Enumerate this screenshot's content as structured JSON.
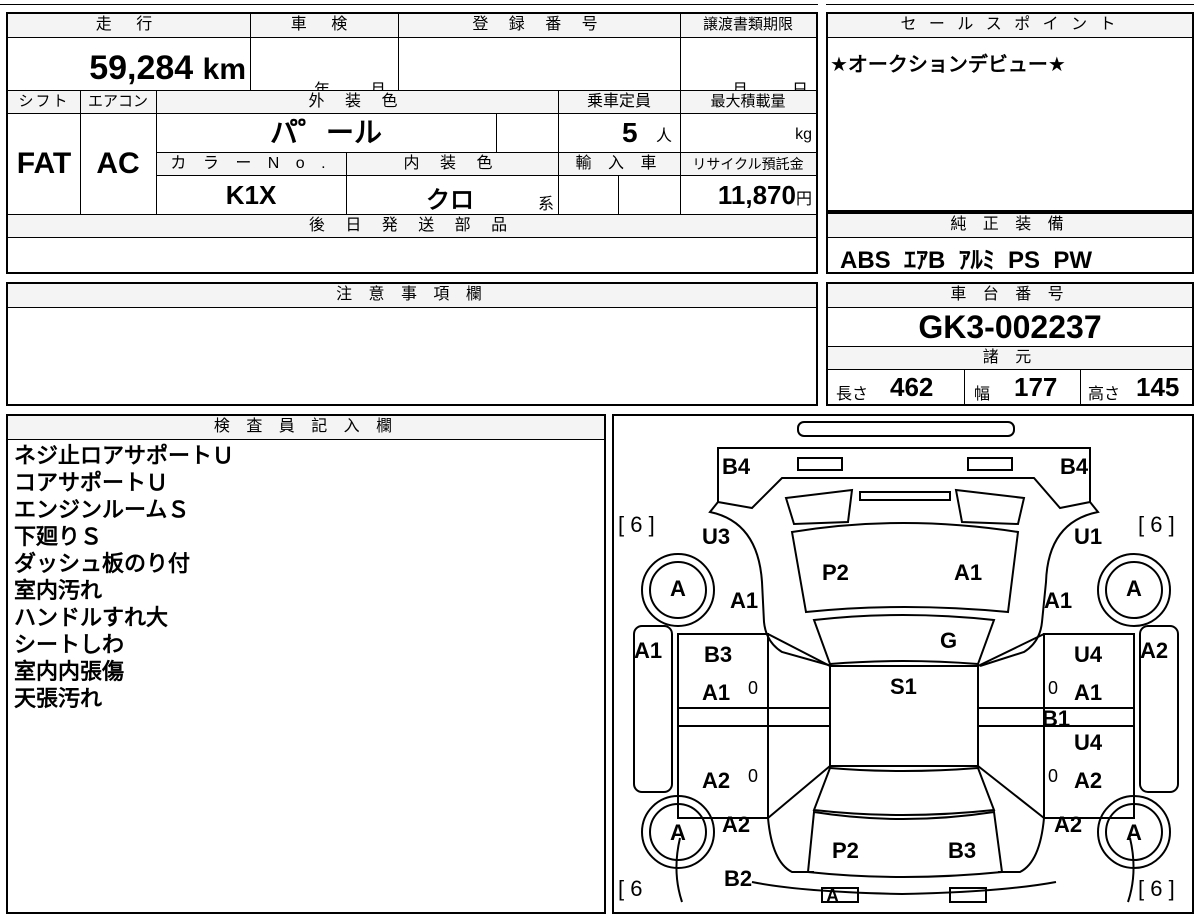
{
  "labels": {
    "mileage": "走 行",
    "inspection": "車 検",
    "registration_no": "登 録 番 号",
    "transfer_deadline": "譲渡書類期限",
    "sales_point": "セ ー ル ス ポ イ ン ト",
    "shift": "シフト",
    "aircon": "エアコン",
    "exterior_color": "外 装 色",
    "capacity": "乗車定員",
    "max_load": "最大積載量",
    "color_no": "カ ラ ー N o .",
    "interior_color": "内 装 色",
    "import": "輸 入 車",
    "recycle_fee": "リサイクル預託金",
    "later_parts": "後 日 発 送 部 品",
    "genuine_equipment": "純 正 装 備",
    "notes": "注 意 事 項 欄",
    "chassis_no": "車 台 番 号",
    "specs": "諸 元",
    "inspector": "検 査 員 記 入 欄"
  },
  "values": {
    "mileage": "59,284",
    "mileage_unit": "km",
    "insp_year": "年",
    "insp_month": "月",
    "deadline_month": "月",
    "deadline_day": "日",
    "sales_point": "★オークションデビュー★",
    "shift": "FAT",
    "aircon": "AC",
    "exterior_color": "パ゜ール",
    "capacity": "5",
    "capacity_unit": "人",
    "load_unit": "kg",
    "color_no": "K1X",
    "interior_color": "クロ",
    "interior_suffix": "系",
    "recycle_fee": "11,870",
    "recycle_unit": "円",
    "genuine_equipment": "ABS  ｴｱB  ｱﾙﾐ  PS  PW",
    "chassis_no": "GK3-002237",
    "length_label": "長さ",
    "length": "462",
    "width_label": "幅",
    "width": "177",
    "height_label": "高さ",
    "height": "145"
  },
  "inspector_notes": [
    "ネジ止ロアサポートＵ",
    "コアサポートＵ",
    "エンジンルームＳ",
    "下廻りＳ",
    "ダッシュ板のり付",
    "室内汚れ",
    "ハンドルすれ大",
    "シートしわ",
    "室内内張傷",
    "天張汚れ"
  ],
  "diagram": {
    "tire_left_top": "[ 6 ]",
    "tire_right_top": "[ 6 ]",
    "tire_left_bottom": "[ 6",
    "tire_right_bottom": "[ 6 ]",
    "wheel": "A",
    "marks": {
      "bumper_front_left": "B4",
      "bumper_front_right": "B4",
      "fender_front_left": "U3",
      "fender_front_right": "U1",
      "hood_left": "P2",
      "hood_right": "A1",
      "wheel_front_left": "A1",
      "wheel_front_right": "A1",
      "windshield": "G",
      "roof": "S1",
      "side_left": "A1",
      "side_right": "A2",
      "front_door_left_1": "B3",
      "front_door_left_2": "A1",
      "front_door_right_1": "U4",
      "front_door_right_2": "A1",
      "pillar_right": "B1",
      "rear_door_right_1": "U4",
      "rear_door_left": "A2",
      "rear_door_right_2": "A2",
      "rear_fender_left": "A2",
      "rear_fender_right": "A2",
      "trunk_left": "P2",
      "trunk_right": "B3",
      "rear_bumper_left": "B2",
      "rear_bumper_center": "A",
      "zero": "0"
    }
  }
}
